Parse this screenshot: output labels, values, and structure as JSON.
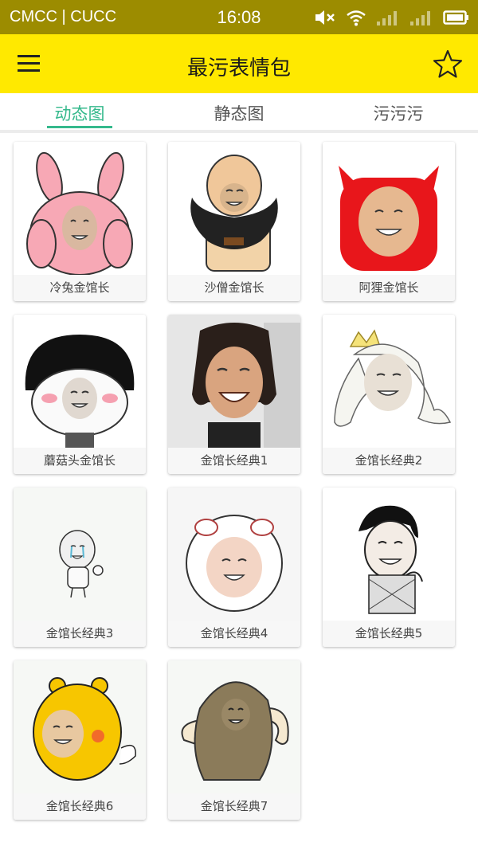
{
  "status_bar": {
    "carrier": "CMCC | CUCC",
    "time": "16:08",
    "icons": [
      "mute-icon",
      "wifi-icon",
      "signal-icon",
      "signal-icon",
      "battery-icon"
    ]
  },
  "app_bar": {
    "title": "最污表情包",
    "menu_icon": "menu-icon",
    "favorite_icon": "star-icon"
  },
  "tabs": [
    {
      "label": "动态图",
      "active": true
    },
    {
      "label": "静态图",
      "active": false
    },
    {
      "label": "污污污",
      "active": false
    }
  ],
  "colors": {
    "status_bar": "#9c8c00",
    "app_bar": "#ffe900",
    "accent": "#35b98c"
  },
  "items": [
    {
      "label": "冷兔金馆长"
    },
    {
      "label": "沙僧金馆长"
    },
    {
      "label": "阿狸金馆长"
    },
    {
      "label": "蘑菇头金馆长"
    },
    {
      "label": "金馆长经典1"
    },
    {
      "label": "金馆长经典2"
    },
    {
      "label": "金馆长经典3"
    },
    {
      "label": "金馆长经典4"
    },
    {
      "label": "金馆长经典5"
    },
    {
      "label": "金馆长经典6"
    },
    {
      "label": "金馆长经典7"
    }
  ]
}
